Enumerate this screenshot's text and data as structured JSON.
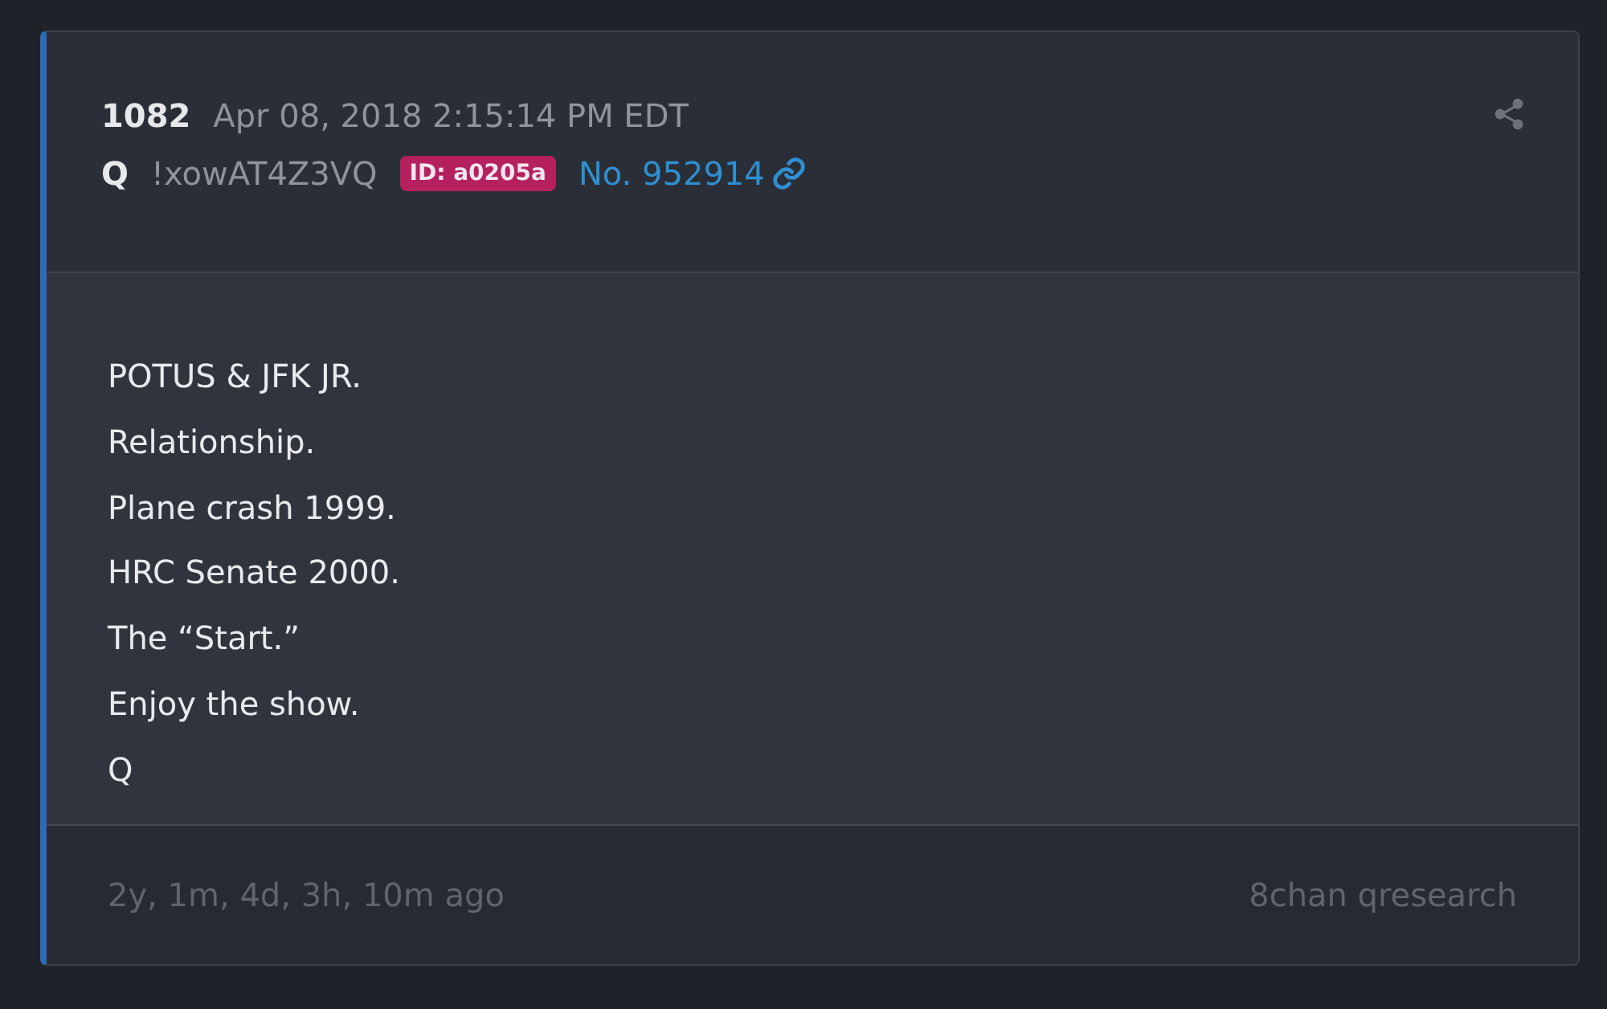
{
  "post": {
    "number": "1082",
    "date": "Apr 08, 2018 2:15:14 PM EDT",
    "author": "Q",
    "tripcode": "!xowAT4Z3VQ",
    "id_badge": "ID: a0205a",
    "post_link": "No. 952914",
    "lines": [
      "POTUS & JFK JR.",
      "Relationship.",
      "Plane crash 1999.",
      "HRC Senate 2000.",
      "The “Start.”",
      "Enjoy the show.",
      "Q"
    ],
    "age": "2y, 1m, 4d, 3h, 10m ago",
    "source": "8chan qresearch"
  }
}
